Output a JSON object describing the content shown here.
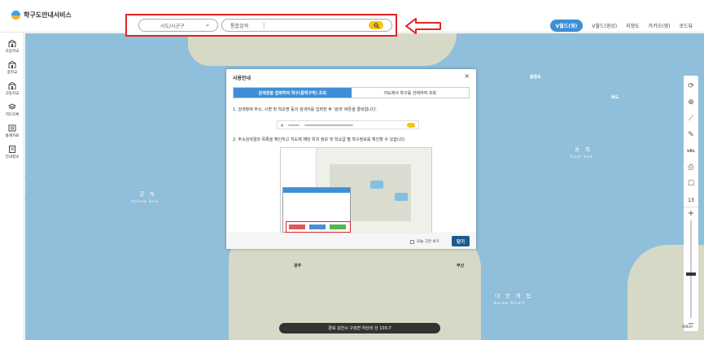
{
  "app": {
    "title": "학구도안내서비스"
  },
  "search": {
    "region_label": "시도/시군구",
    "query_label": "통합검색"
  },
  "map_types": [
    {
      "label": "V월드(영)",
      "active": true
    },
    {
      "label": "V월드(영상)",
      "active": false
    },
    {
      "label": "지형도",
      "active": false
    },
    {
      "label": "카카오(영)",
      "active": false
    },
    {
      "label": "로드뷰",
      "active": false
    }
  ],
  "sidebar": {
    "items": [
      {
        "label": "초등학교",
        "icon": "school-icon"
      },
      {
        "label": "중학교",
        "icon": "school-icon"
      },
      {
        "label": "고등학교",
        "icon": "school-icon"
      },
      {
        "label": "지도목록",
        "icon": "layers-icon"
      },
      {
        "label": "통계자료",
        "icon": "stats-icon"
      },
      {
        "label": "안내정보",
        "icon": "info-icon"
      }
    ]
  },
  "map": {
    "labels": {
      "east_sea": "동 해",
      "east_sea_en": "East Sea",
      "yellow_sea": "황 해",
      "yellow_sea_en": "Yellow Sea",
      "korea_strait": "대 한 해 협",
      "korea_strait_en": "Korea Strait",
      "ulleungdo": "울릉도",
      "dokdo": "독도",
      "gwangju": "광주",
      "busan": "부산"
    },
    "tools": [
      "refresh-icon",
      "globe-icon",
      "measure-icon",
      "draw-icon",
      "URL",
      "print-icon",
      "edit-icon",
      "location-icon"
    ],
    "zoom_level": "13",
    "zoom_fraction": 0.45,
    "bottom_address": "경북 김천시 구성면 하산리 산 103-7",
    "scale": "60km"
  },
  "dialog": {
    "title": "사용안내",
    "tabs": [
      {
        "label": "검색창을 입력하여 학구(통학구역) 조회",
        "active": true
      },
      {
        "label": "지도에서 학구를 선택하여 조회",
        "active": false
      }
    ],
    "step1": "1. 검색창에 주소, 시명 및 학교명 등의 검색어를 입력한 후 '검색' 버튼을 클릭합니다.",
    "step2": "2. 주소검색결과 목록을 확인하고 지도에 해당 위치 정보 및 학교급 별 학구정보를 확인할 수 있습니다.",
    "no_more_label": "오늘 그만 보기",
    "close_label": "닫기"
  },
  "colors": {
    "accent": "#3f8fd6",
    "highlight": "#e02424",
    "search_button": "#f6c413",
    "sea": "#8fbfda",
    "land": "#d7d9c7"
  }
}
